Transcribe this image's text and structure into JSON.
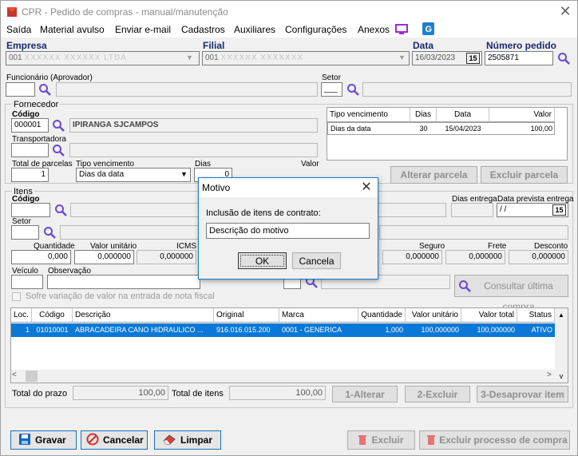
{
  "window": {
    "title": "CPR - Pedido de compras - manual/manutenção"
  },
  "menu": [
    "Saída",
    "Material avulso",
    "Enviar e-mail",
    "Cadastros",
    "Auxiliares",
    "Configurações",
    "Anexos"
  ],
  "header": {
    "empresa_label": "Empresa",
    "empresa_code": "001",
    "empresa_name": "XXXXXX XXXXXX LTDA",
    "filial_label": "Filial",
    "filial_code": "001",
    "filial_name": "XXXXXX XXXXXXX",
    "data_label": "Data",
    "data_value": "16/03/2023",
    "date_btn": "15",
    "numero_label": "Número pedido",
    "numero_value": "2505871",
    "funcionario_label": "Funcionário (Aprovador)",
    "setor_label": "Setor",
    "setor_value": "___"
  },
  "fornecedor": {
    "group": "Fornecedor",
    "codigo_label": "Código",
    "codigo_value": "000001",
    "nome": "IPIRANGA SJCAMPOS",
    "transportadora_label": "Transportadora",
    "total_parcelas_label": "Total de parcelas",
    "total_parcelas_value": "1",
    "tipo_venc_label": "Tipo vencimento",
    "tipo_venc_value": "Dias da data",
    "dias_label": "Dias",
    "dias_value": "0",
    "valor_label": "Valor"
  },
  "parcelas": {
    "headers": [
      "Tipo vencimento",
      "Dias",
      "Data",
      "Valor"
    ],
    "rows": [
      {
        "tipo": "Dias da data",
        "dias": "30",
        "data": "15/04/2023",
        "valor": "100,00"
      }
    ],
    "alterar": "Alterar parcela",
    "excluir": "Excluir parcela"
  },
  "itens": {
    "group": "Itens",
    "codigo_label": "Código",
    "setor_label": "Setor",
    "dias_entrega_label": "Dias entrega",
    "data_prevista_label": "Data prevista entrega",
    "data_prevista_value": "/ /",
    "date_btn": "15",
    "quantidade_label": "Quantidade",
    "quantidade_value": "0,000",
    "valor_unit_label": "Valor unitário",
    "valor_unit_value": "0,000000",
    "icms_label": "ICMS",
    "icms_value": "0,000000",
    "seguro_label": "Seguro",
    "seguro_value": "0,000000",
    "frete_label": "Frete",
    "frete_value": "0,000000",
    "desconto_label": "Desconto",
    "desconto_value": "0,000000",
    "veiculo_label": "Veículo",
    "observacao_label": "Observação",
    "sofre_label": "Sofre variação de valor na entrada de nota fiscal",
    "consultar_btn": "Consultar última compra",
    "grid_headers": [
      "Loc.",
      "Código",
      "Descrição",
      "Original",
      "Marca",
      "Quantidade",
      "Valor unitário",
      "Valor total",
      "Status"
    ],
    "grid_rows": [
      {
        "loc": "1",
        "codigo": "01010001",
        "descricao": "ABRACADEIRA CANO HIDRAULICO ...",
        "original": "916.016.015.200",
        "marca": "0001 - GENERICA",
        "quantidade": "1,000",
        "valor_unit": "100,000000",
        "valor_total": "100,000000",
        "status": "ATIVO"
      }
    ],
    "total_prazo_label": "Total do prazo",
    "total_prazo_value": "100,00",
    "total_itens_label": "Total de itens",
    "total_itens_value": "100,00",
    "btn_alterar": "1-Alterar",
    "btn_excluir": "2-Excluir",
    "btn_desaprovar": "3-Desaprovar item"
  },
  "footer": {
    "gravar": "Gravar",
    "cancelar": "Cancelar",
    "limpar": "Limpar",
    "excluir": "Excluir",
    "excluir_processo": "Excluir processo de compra"
  },
  "dialog": {
    "title": "Motivo",
    "prompt": "Inclusão de itens de contrato:",
    "value": "Descrição do motivo",
    "ok": "OK",
    "cancel": "Cancela"
  },
  "colors": {
    "accent": "#1a2a6e",
    "selection": "#0a78d7",
    "focus_border": "#1979ca",
    "magnifier": "#6a4bd0"
  }
}
